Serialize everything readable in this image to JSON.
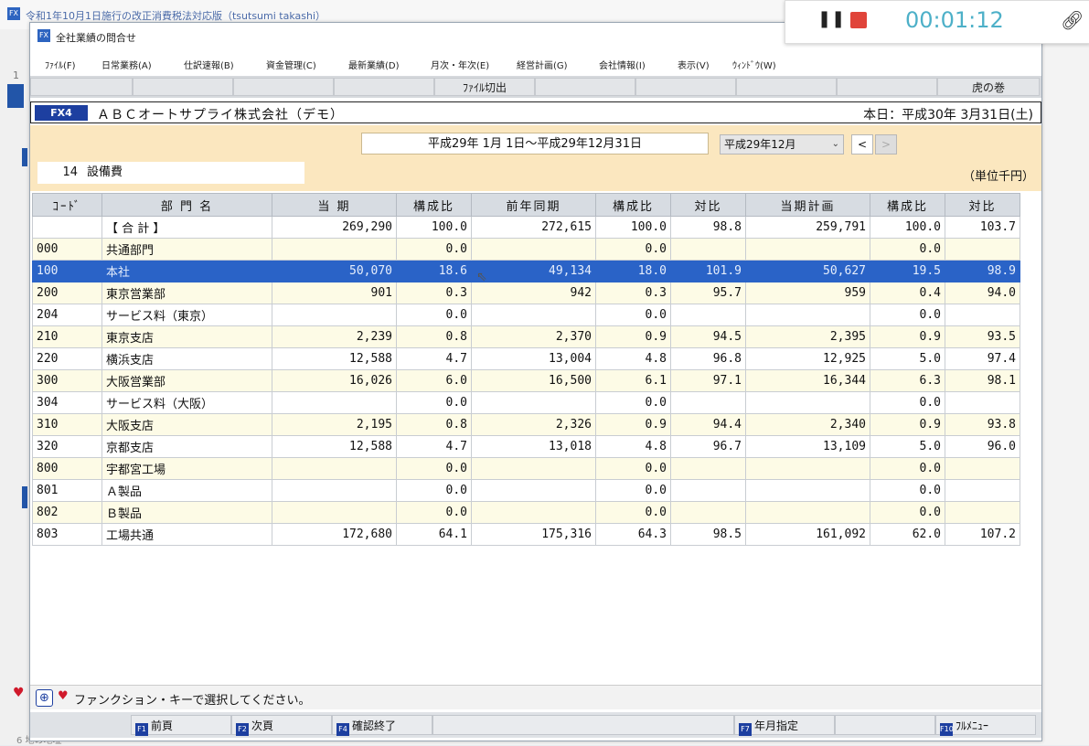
{
  "background_app": {
    "title": "令和1年10月1日施行の改正消費税法対応版（tsutsumi takashi）",
    "left_number": "1",
    "footer": "6 地の地址"
  },
  "window": {
    "title": "全社業績の問合せ",
    "menu": [
      "ﾌｧｲﾙ(F)",
      "日常業務(A)",
      "仕訳速報(B)",
      "資金管理(C)",
      "最新業績(D)",
      "月次・年次(E)",
      "経営計画(G)",
      "会社情報(I)",
      "表示(V)",
      "ｳｨﾝﾄﾞｳ(W)"
    ],
    "fn_row": {
      "file_output": "ﾌｧｲﾙ切出",
      "help": "虎の巻"
    },
    "company": {
      "code": "FX4",
      "name": "ＡＢＣオートサプライ株式会社（デモ）",
      "today": "本日：平成30年 3月31日(土)"
    },
    "filter": {
      "period": "平成29年 1月 1日～平成29年12月31日",
      "month_selected": "平成29年12月",
      "prev_label": "<",
      "next_label": ">",
      "account_code": "14",
      "account_name": "設備費",
      "unit": "（単位千円）"
    }
  },
  "table": {
    "headers": [
      "ｺｰﾄﾞ",
      "部 門 名",
      "当 期",
      "構成比",
      "前年同期",
      "構成比",
      "対比",
      "当期計画",
      "構成比",
      "対比"
    ],
    "rows": [
      {
        "code": "",
        "name": "【 合 計 】",
        "current": "269,290",
        "ratio1": "100.0",
        "prev": "272,615",
        "ratio2": "100.0",
        "comp1": "98.8",
        "plan": "259,791",
        "ratio3": "100.0",
        "comp2": "103.7"
      },
      {
        "code": "000",
        "name": "共通部門",
        "current": "",
        "ratio1": "0.0",
        "prev": "",
        "ratio2": "0.0",
        "comp1": "",
        "plan": "",
        "ratio3": "0.0",
        "comp2": ""
      },
      {
        "code": "100",
        "name": "本社",
        "current": "50,070",
        "ratio1": "18.6",
        "prev": "49,134",
        "ratio2": "18.0",
        "comp1": "101.9",
        "plan": "50,627",
        "ratio3": "19.5",
        "comp2": "98.9"
      },
      {
        "code": "200",
        "name": "東京営業部",
        "current": "901",
        "ratio1": "0.3",
        "prev": "942",
        "ratio2": "0.3",
        "comp1": "95.7",
        "plan": "959",
        "ratio3": "0.4",
        "comp2": "94.0"
      },
      {
        "code": "204",
        "name": "サービス料（東京）",
        "current": "",
        "ratio1": "0.0",
        "prev": "",
        "ratio2": "0.0",
        "comp1": "",
        "plan": "",
        "ratio3": "0.0",
        "comp2": ""
      },
      {
        "code": "210",
        "name": "東京支店",
        "current": "2,239",
        "ratio1": "0.8",
        "prev": "2,370",
        "ratio2": "0.9",
        "comp1": "94.5",
        "plan": "2,395",
        "ratio3": "0.9",
        "comp2": "93.5"
      },
      {
        "code": "220",
        "name": "横浜支店",
        "current": "12,588",
        "ratio1": "4.7",
        "prev": "13,004",
        "ratio2": "4.8",
        "comp1": "96.8",
        "plan": "12,925",
        "ratio3": "5.0",
        "comp2": "97.4"
      },
      {
        "code": "300",
        "name": "大阪営業部",
        "current": "16,026",
        "ratio1": "6.0",
        "prev": "16,500",
        "ratio2": "6.1",
        "comp1": "97.1",
        "plan": "16,344",
        "ratio3": "6.3",
        "comp2": "98.1"
      },
      {
        "code": "304",
        "name": "サービス料（大阪）",
        "current": "",
        "ratio1": "0.0",
        "prev": "",
        "ratio2": "0.0",
        "comp1": "",
        "plan": "",
        "ratio3": "0.0",
        "comp2": ""
      },
      {
        "code": "310",
        "name": "大阪支店",
        "current": "2,195",
        "ratio1": "0.8",
        "prev": "2,326",
        "ratio2": "0.9",
        "comp1": "94.4",
        "plan": "2,340",
        "ratio3": "0.9",
        "comp2": "93.8"
      },
      {
        "code": "320",
        "name": "京都支店",
        "current": "12,588",
        "ratio1": "4.7",
        "prev": "13,018",
        "ratio2": "4.8",
        "comp1": "96.7",
        "plan": "13,109",
        "ratio3": "5.0",
        "comp2": "96.0"
      },
      {
        "code": "800",
        "name": "宇都宮工場",
        "current": "",
        "ratio1": "0.0",
        "prev": "",
        "ratio2": "0.0",
        "comp1": "",
        "plan": "",
        "ratio3": "0.0",
        "comp2": ""
      },
      {
        "code": "801",
        "name": "Ａ製品",
        "current": "",
        "ratio1": "0.0",
        "prev": "",
        "ratio2": "0.0",
        "comp1": "",
        "plan": "",
        "ratio3": "0.0",
        "comp2": ""
      },
      {
        "code": "802",
        "name": "Ｂ製品",
        "current": "",
        "ratio1": "0.0",
        "prev": "",
        "ratio2": "0.0",
        "comp1": "",
        "plan": "",
        "ratio3": "0.0",
        "comp2": ""
      },
      {
        "code": "803",
        "name": "工場共通",
        "current": "172,680",
        "ratio1": "64.1",
        "prev": "175,316",
        "ratio2": "64.3",
        "comp1": "98.5",
        "plan": "161,092",
        "ratio3": "62.0",
        "comp2": "107.2"
      }
    ],
    "selected_row": 2
  },
  "status": {
    "message": "ファンクション・キーで選択してください。"
  },
  "fkeys": [
    {
      "badge": "F1",
      "label": "前頁"
    },
    {
      "badge": "F2",
      "label": "次頁"
    },
    {
      "badge": "F4",
      "label": "確認終了"
    },
    {
      "badge": "F7",
      "label": "年月指定"
    },
    {
      "badge": "F10",
      "label": "ﾌﾙﾒﾆｭｰ"
    }
  ],
  "recorder": {
    "timer": "00:01:12"
  },
  "colors": {
    "selected_row": "#2a63c7",
    "filter_bg": "#fbe7bf",
    "company_badge": "#1d3fa0",
    "timer": "#4db0c8",
    "stop": "#e0443a"
  }
}
